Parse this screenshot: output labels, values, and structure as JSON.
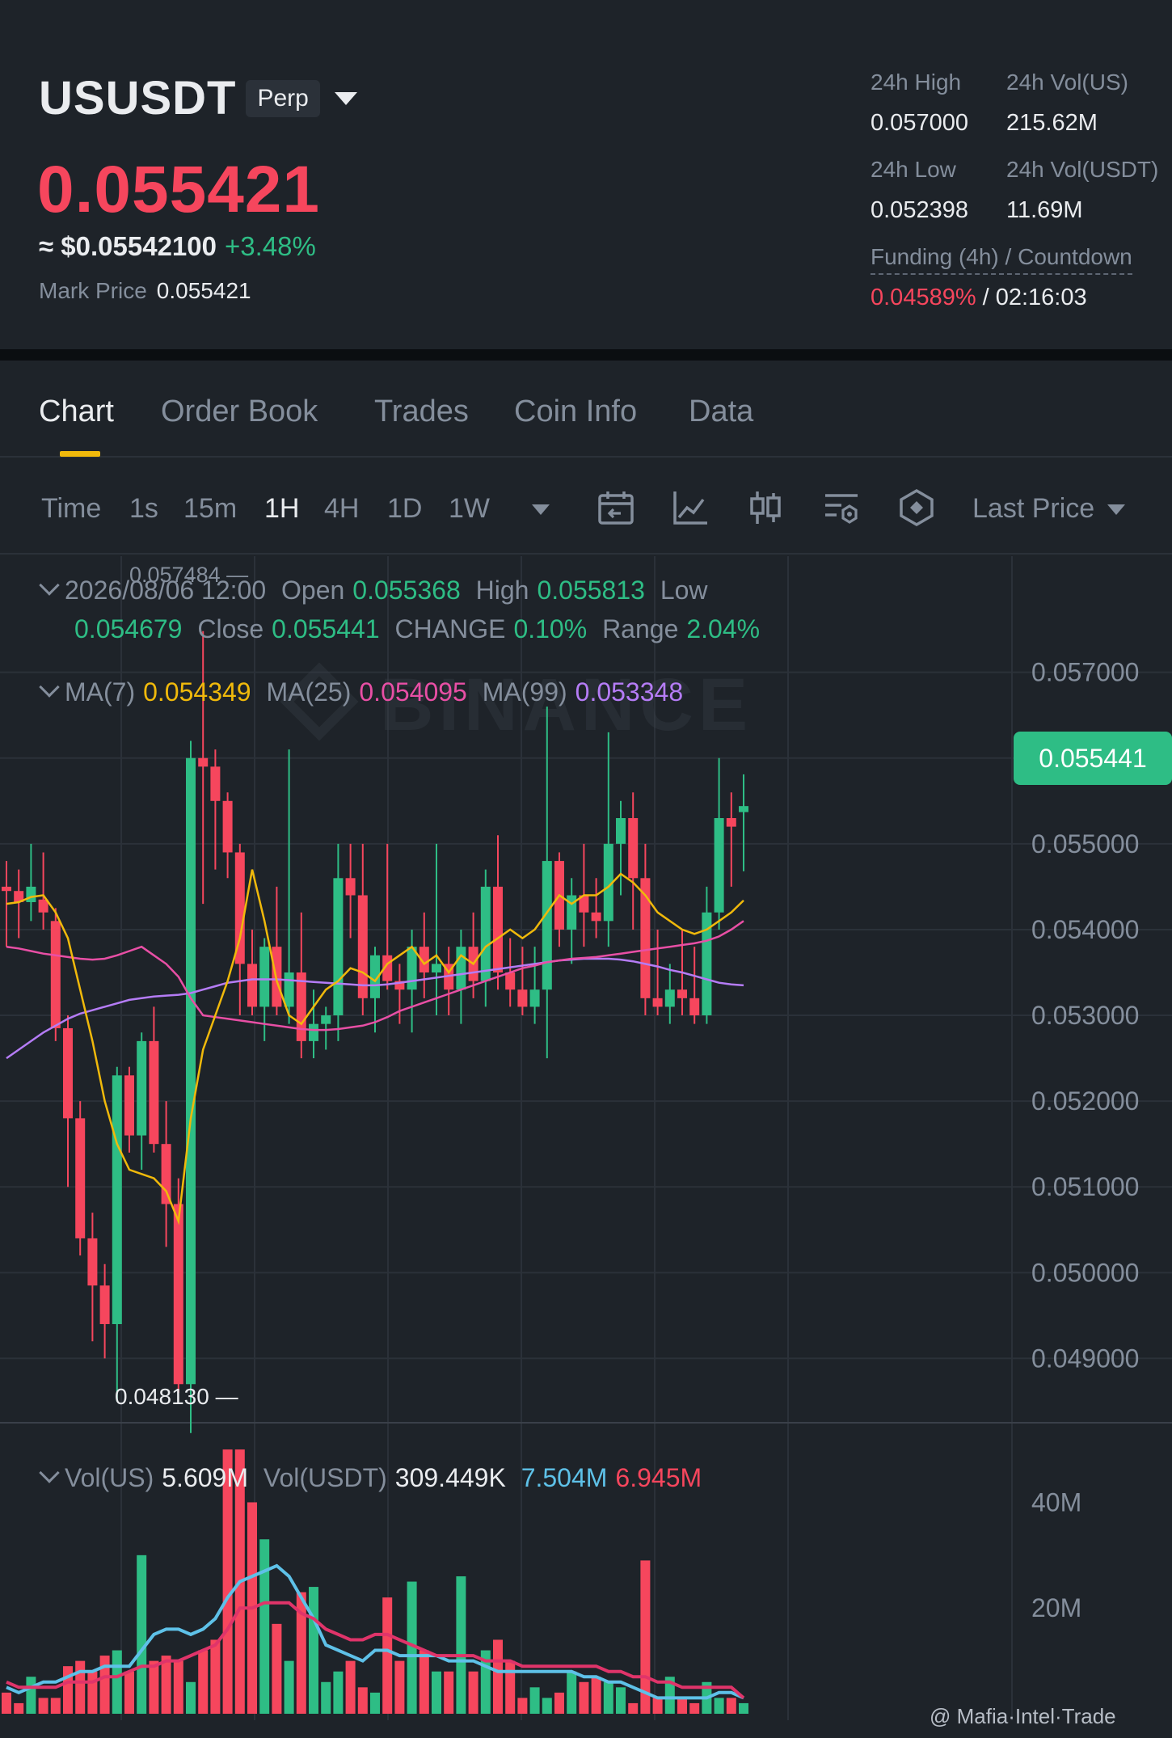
{
  "header": {
    "symbol": "USUSDT",
    "badge": "Perp",
    "last_price": "0.055421",
    "usd_approx": "≈ $0.05542100",
    "change_pct": "+3.48%",
    "mark_price_label": "Mark Price",
    "mark_price": "0.055421",
    "stats": {
      "high_label": "24h High",
      "high": "0.057000",
      "vol_us_label": "24h Vol(US)",
      "vol_us": "215.62M",
      "low_label": "24h Low",
      "low": "0.052398",
      "vol_usdt_label": "24h Vol(USDT)",
      "vol_usdt": "11.69M",
      "funding_label": "Funding (4h) / Countdown",
      "funding_rate": "0.04589%",
      "funding_sep": "/",
      "countdown": "02:16:03"
    }
  },
  "tabs": [
    "Chart",
    "Order Book",
    "Trades",
    "Coin Info",
    "Data"
  ],
  "toolbar": {
    "timeframes": [
      "Time",
      "1s",
      "15m",
      "1H",
      "4H",
      "1D",
      "1W"
    ],
    "active_timeframe": "1H",
    "icons": [
      "calendar-icon",
      "indicator-icon",
      "candle-type-icon",
      "settings-icon",
      "depth-icon"
    ],
    "price_type": "Last Price"
  },
  "legend": {
    "datetime": "2026/08/06 12:00",
    "open_label": "Open",
    "open": "0.055368",
    "high_label": "High",
    "high": "0.055813",
    "low_label": "Low",
    "low": "0.054679",
    "close_label": "Close",
    "close": "0.055441",
    "change_label": "CHANGE",
    "change": "0.10%",
    "range_label": "Range",
    "range": "2.04%",
    "ma7_label": "MA(7)",
    "ma7": "0.054349",
    "ma25_label": "MA(25)",
    "ma25": "0.054095",
    "ma99_label": "MA(99)",
    "ma99": "0.053348",
    "vol_us_label": "Vol(US)",
    "vol_us": "5.609M",
    "vol_usdt_label": "Vol(USDT)",
    "vol_usdt": "309.449K",
    "vol_ma1": "7.504M",
    "vol_ma2": "6.945M"
  },
  "chart_notes": {
    "high_marker": "0.057484 —",
    "low_marker": "0.048130 —",
    "current_tag": "0.055441"
  },
  "watermark": "@ Mafia·Intel·Trade",
  "colors": {
    "up": "#2ebd85",
    "down": "#f6465d",
    "ma7": "#f0b90b",
    "ma25": "#e84fa5",
    "ma99": "#b57cf6",
    "vol_ma1": "#5ec1e8",
    "vol_ma2": "#e0346a",
    "accent": "#f0b90b"
  },
  "chart_data": {
    "type": "candlestick",
    "price_axis": [
      "0.057000",
      "0.056000",
      "0.055000",
      "0.054000",
      "0.053000",
      "0.052000",
      "0.051000",
      "0.050000",
      "0.049000"
    ],
    "volume_axis": [
      "40M",
      "20M"
    ],
    "ylim": [
      0.04825,
      0.0576
    ],
    "candles": [
      {
        "o": 0.0545,
        "h": 0.0548,
        "l": 0.0538,
        "c": 0.05445
      },
      {
        "o": 0.05445,
        "h": 0.0547,
        "l": 0.0539,
        "c": 0.05432
      },
      {
        "o": 0.05432,
        "h": 0.055,
        "l": 0.0541,
        "c": 0.0545
      },
      {
        "o": 0.05435,
        "h": 0.0549,
        "l": 0.054,
        "c": 0.0542
      },
      {
        "o": 0.0541,
        "h": 0.05425,
        "l": 0.0527,
        "c": 0.05285
      },
      {
        "o": 0.05285,
        "h": 0.053,
        "l": 0.051,
        "c": 0.0518
      },
      {
        "o": 0.0518,
        "h": 0.052,
        "l": 0.0502,
        "c": 0.0504
      },
      {
        "o": 0.0504,
        "h": 0.0507,
        "l": 0.0492,
        "c": 0.04985
      },
      {
        "o": 0.04985,
        "h": 0.0501,
        "l": 0.049,
        "c": 0.0494
      },
      {
        "o": 0.0494,
        "h": 0.0524,
        "l": 0.0485,
        "c": 0.0523
      },
      {
        "o": 0.0523,
        "h": 0.0524,
        "l": 0.0514,
        "c": 0.0516
      },
      {
        "o": 0.0516,
        "h": 0.0528,
        "l": 0.0512,
        "c": 0.0527
      },
      {
        "o": 0.0527,
        "h": 0.0531,
        "l": 0.0514,
        "c": 0.0515
      },
      {
        "o": 0.0515,
        "h": 0.052,
        "l": 0.0503,
        "c": 0.0508
      },
      {
        "o": 0.0508,
        "h": 0.0511,
        "l": 0.0486,
        "c": 0.0487
      },
      {
        "o": 0.0487,
        "h": 0.0562,
        "l": 0.04813,
        "c": 0.056
      },
      {
        "o": 0.056,
        "h": 0.05748,
        "l": 0.0543,
        "c": 0.0559
      },
      {
        "o": 0.0559,
        "h": 0.0561,
        "l": 0.0547,
        "c": 0.0555
      },
      {
        "o": 0.0555,
        "h": 0.0556,
        "l": 0.0546,
        "c": 0.0549
      },
      {
        "o": 0.0549,
        "h": 0.055,
        "l": 0.053,
        "c": 0.0536
      },
      {
        "o": 0.0536,
        "h": 0.054,
        "l": 0.053,
        "c": 0.0531
      },
      {
        "o": 0.0531,
        "h": 0.0539,
        "l": 0.0527,
        "c": 0.0538
      },
      {
        "o": 0.0538,
        "h": 0.0545,
        "l": 0.053,
        "c": 0.0531
      },
      {
        "o": 0.0531,
        "h": 0.0561,
        "l": 0.0529,
        "c": 0.0535
      },
      {
        "o": 0.0535,
        "h": 0.0542,
        "l": 0.0525,
        "c": 0.0527
      },
      {
        "o": 0.0527,
        "h": 0.0533,
        "l": 0.0525,
        "c": 0.0529
      },
      {
        "o": 0.0529,
        "h": 0.0531,
        "l": 0.0526,
        "c": 0.053
      },
      {
        "o": 0.053,
        "h": 0.055,
        "l": 0.0527,
        "c": 0.0546
      },
      {
        "o": 0.0546,
        "h": 0.055,
        "l": 0.0539,
        "c": 0.0544
      },
      {
        "o": 0.0544,
        "h": 0.055,
        "l": 0.053,
        "c": 0.0532
      },
      {
        "o": 0.0532,
        "h": 0.0538,
        "l": 0.0528,
        "c": 0.0537
      },
      {
        "o": 0.0537,
        "h": 0.055,
        "l": 0.0533,
        "c": 0.0534
      },
      {
        "o": 0.0534,
        "h": 0.0536,
        "l": 0.0529,
        "c": 0.0533
      },
      {
        "o": 0.0533,
        "h": 0.054,
        "l": 0.0528,
        "c": 0.0538
      },
      {
        "o": 0.0538,
        "h": 0.0542,
        "l": 0.0532,
        "c": 0.0535
      },
      {
        "o": 0.0535,
        "h": 0.055,
        "l": 0.053,
        "c": 0.0536
      },
      {
        "o": 0.0536,
        "h": 0.0538,
        "l": 0.053,
        "c": 0.0533
      },
      {
        "o": 0.0533,
        "h": 0.054,
        "l": 0.0529,
        "c": 0.0538
      },
      {
        "o": 0.0538,
        "h": 0.0542,
        "l": 0.0532,
        "c": 0.0534
      },
      {
        "o": 0.0534,
        "h": 0.0547,
        "l": 0.0531,
        "c": 0.0545
      },
      {
        "o": 0.0545,
        "h": 0.0551,
        "l": 0.0533,
        "c": 0.0535
      },
      {
        "o": 0.0535,
        "h": 0.0539,
        "l": 0.0531,
        "c": 0.0533
      },
      {
        "o": 0.0533,
        "h": 0.0538,
        "l": 0.053,
        "c": 0.0531
      },
      {
        "o": 0.0531,
        "h": 0.0538,
        "l": 0.0529,
        "c": 0.0533
      },
      {
        "o": 0.0533,
        "h": 0.0566,
        "l": 0.0525,
        "c": 0.0548
      },
      {
        "o": 0.0548,
        "h": 0.0549,
        "l": 0.0538,
        "c": 0.054
      },
      {
        "o": 0.054,
        "h": 0.0546,
        "l": 0.0536,
        "c": 0.0544
      },
      {
        "o": 0.0544,
        "h": 0.055,
        "l": 0.0538,
        "c": 0.0542
      },
      {
        "o": 0.0542,
        "h": 0.0546,
        "l": 0.0539,
        "c": 0.0541
      },
      {
        "o": 0.0541,
        "h": 0.0563,
        "l": 0.0538,
        "c": 0.055
      },
      {
        "o": 0.055,
        "h": 0.0555,
        "l": 0.0544,
        "c": 0.0553
      },
      {
        "o": 0.0553,
        "h": 0.0556,
        "l": 0.054,
        "c": 0.0546
      },
      {
        "o": 0.0546,
        "h": 0.055,
        "l": 0.053,
        "c": 0.0532
      },
      {
        "o": 0.0532,
        "h": 0.054,
        "l": 0.053,
        "c": 0.0531
      },
      {
        "o": 0.0531,
        "h": 0.0536,
        "l": 0.0529,
        "c": 0.0533
      },
      {
        "o": 0.0533,
        "h": 0.054,
        "l": 0.053,
        "c": 0.0532
      },
      {
        "o": 0.0532,
        "h": 0.0538,
        "l": 0.0529,
        "c": 0.053
      },
      {
        "o": 0.053,
        "h": 0.0545,
        "l": 0.0529,
        "c": 0.0542
      },
      {
        "o": 0.0542,
        "h": 0.056,
        "l": 0.054,
        "c": 0.0553
      },
      {
        "o": 0.0553,
        "h": 0.0556,
        "l": 0.0545,
        "c": 0.0552
      },
      {
        "o": 0.05537,
        "h": 0.05581,
        "l": 0.05468,
        "c": 0.05544
      }
    ],
    "ma7": [
      0.0543,
      0.05432,
      0.05438,
      0.0544,
      0.0542,
      0.0539,
      0.0533,
      0.0527,
      0.052,
      0.0515,
      0.0512,
      0.05115,
      0.0511,
      0.05095,
      0.0506,
      0.0518,
      0.0526,
      0.053,
      0.0534,
      0.0539,
      0.0547,
      0.0541,
      0.0534,
      0.053,
      0.0529,
      0.0531,
      0.0533,
      0.0534,
      0.05355,
      0.0535,
      0.0534,
      0.0536,
      0.0537,
      0.0538,
      0.0536,
      0.0537,
      0.0535,
      0.0537,
      0.0536,
      0.0538,
      0.0539,
      0.054,
      0.0539,
      0.054,
      0.0542,
      0.0544,
      0.0543,
      0.0544,
      0.0544,
      0.0545,
      0.05465,
      0.05455,
      0.0544,
      0.0542,
      0.0541,
      0.054,
      0.05395,
      0.054,
      0.0541,
      0.0542,
      0.05434
    ],
    "ma25": [
      0.0538,
      0.05378,
      0.05375,
      0.05372,
      0.0537,
      0.05368,
      0.05366,
      0.05365,
      0.05366,
      0.0537,
      0.05375,
      0.0538,
      0.0537,
      0.0536,
      0.05345,
      0.0532,
      0.053,
      0.05298,
      0.05296,
      0.05294,
      0.05292,
      0.0529,
      0.05288,
      0.05286,
      0.05284,
      0.05283,
      0.05283,
      0.05284,
      0.05286,
      0.05288,
      0.05292,
      0.05298,
      0.05305,
      0.0531,
      0.05315,
      0.0532,
      0.05325,
      0.0533,
      0.05335,
      0.0534,
      0.05345,
      0.0535,
      0.05355,
      0.05358,
      0.05362,
      0.05364,
      0.05366,
      0.05367,
      0.05368,
      0.0537,
      0.05372,
      0.05374,
      0.05376,
      0.05378,
      0.0538,
      0.05382,
      0.05384,
      0.05387,
      0.05392,
      0.054,
      0.0541
    ],
    "ma99": [
      0.0525,
      0.0526,
      0.0527,
      0.0528,
      0.05288,
      0.05296,
      0.05302,
      0.05306,
      0.0531,
      0.05314,
      0.05318,
      0.0532,
      0.05322,
      0.05323,
      0.05324,
      0.05326,
      0.0533,
      0.05334,
      0.05338,
      0.0534,
      0.05342,
      0.05342,
      0.05342,
      0.05341,
      0.0534,
      0.05339,
      0.05338,
      0.05337,
      0.05336,
      0.05335,
      0.05335,
      0.05336,
      0.05338,
      0.0534,
      0.05342,
      0.05344,
      0.05346,
      0.05348,
      0.0535,
      0.05352,
      0.05354,
      0.05356,
      0.05358,
      0.0536,
      0.05362,
      0.05364,
      0.05365,
      0.05366,
      0.05366,
      0.05366,
      0.05365,
      0.05363,
      0.0536,
      0.05357,
      0.05353,
      0.0535,
      0.05346,
      0.05342,
      0.05338,
      0.05336,
      0.05335
    ],
    "volume_M": [
      4,
      2,
      7,
      3,
      3,
      9,
      10,
      8,
      11,
      12,
      8,
      30,
      10,
      11,
      10,
      6,
      12,
      14,
      50,
      50,
      40,
      33,
      17,
      10,
      23,
      24,
      6,
      8,
      10,
      5,
      4,
      22,
      10,
      25,
      12,
      8,
      8,
      26,
      8,
      12,
      14,
      10,
      3,
      5,
      3,
      4,
      8,
      6,
      7,
      6,
      5,
      2,
      29,
      3,
      7,
      3,
      2,
      6,
      3,
      3,
      2
    ],
    "vol_ma1": [
      5,
      4,
      5,
      6,
      6,
      7,
      8,
      8,
      9,
      9,
      9,
      12,
      15,
      16,
      16,
      15,
      16,
      18,
      22,
      25,
      26,
      27,
      28,
      26,
      22,
      18,
      13,
      12,
      11,
      10,
      12,
      12,
      11,
      11,
      11,
      11,
      10,
      10,
      10,
      9,
      8,
      8,
      8,
      8,
      8,
      8,
      8,
      7,
      7,
      6,
      6,
      5,
      4,
      3,
      3,
      3,
      3,
      3,
      4,
      4,
      3
    ],
    "vol_ma2": [
      6,
      5,
      5,
      5,
      5,
      6,
      6,
      6,
      7,
      7,
      8,
      9,
      9,
      10,
      10,
      11,
      12,
      13,
      16,
      20,
      20,
      21,
      21,
      21,
      19,
      18,
      16,
      15,
      14,
      14,
      15,
      15,
      14,
      13,
      12,
      11,
      11,
      11,
      11,
      10,
      10,
      10,
      9,
      9,
      9,
      9,
      9,
      9,
      9,
      8,
      8,
      7,
      7,
      6,
      6,
      5,
      5,
      5,
      5,
      5,
      3
    ]
  }
}
